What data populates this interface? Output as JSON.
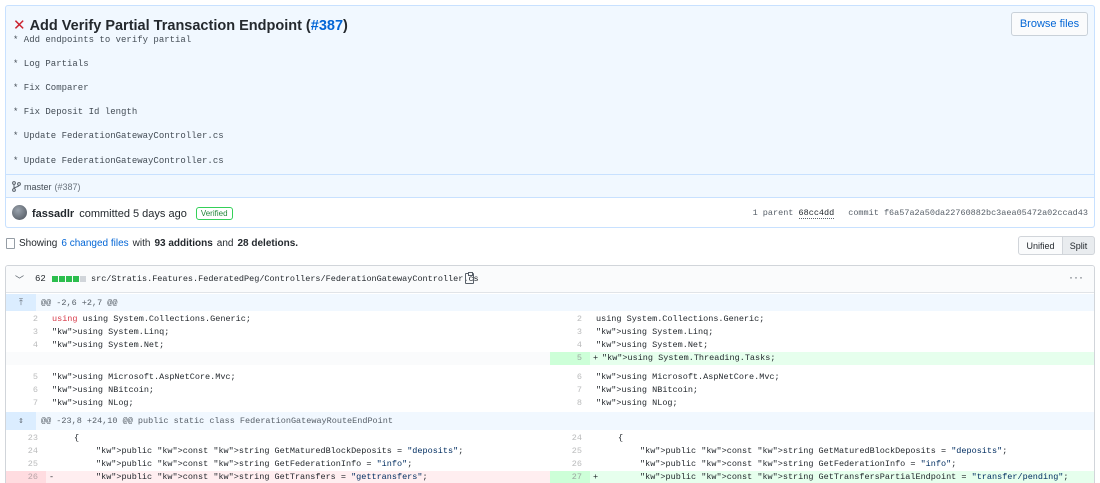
{
  "commit": {
    "status_icon": "x-icon",
    "title": "Add Verify Partial Transaction Endpoint (",
    "pr_link": "#387",
    "title_suffix": ")",
    "browse_label": "Browse files",
    "message_lines": [
      "* Add endpoints to verify partial",
      "* Log Partials",
      "* Fix Comparer",
      "* Fix Deposit Id length",
      "* Update FederationGatewayController.cs",
      "* Update FederationGatewayController.cs"
    ],
    "branch": "master",
    "branch_pr": "(#387)",
    "author": "fassadlr",
    "committed_text": "committed 5 days ago",
    "verified_label": "Verified",
    "parent_label": "1 parent",
    "parent_sha": "68cc4dd",
    "commit_label": "commit",
    "commit_sha": "f6a57a2a50da22760882bc3aea05472a02ccad43"
  },
  "summary": {
    "prefix": "Showing",
    "changed_files": "6 changed files",
    "with": "with",
    "additions": "93 additions",
    "and": "and",
    "deletions": "28 deletions."
  },
  "view_toggle": {
    "unified": "Unified",
    "split": "Split"
  },
  "file": {
    "change_count": "62",
    "path": "src/Stratis.Features.FederatedPeg/Controllers/FederationGatewayController.cs",
    "more": "···",
    "diffstat": [
      "add",
      "add",
      "add",
      "add",
      "neutral"
    ],
    "hunks": [
      {
        "header": "@@ -2,6 +2,7 @@"
      },
      {
        "header": "@@ -23,8 +24,10 @@ public static class FederationGatewayRouteEndPoint"
      }
    ],
    "lines": {
      "l1_left_num": "2",
      "l1_left": "using System.Collections.Generic;",
      "l1_right_num": "2",
      "l1_right": "using System.Collections.Generic;",
      "l2_left_num": "3",
      "l2_left": "using System.Linq;",
      "l2_right_num": "3",
      "l2_right": "using System.Linq;",
      "l3_left_num": "4",
      "l3_left": "using System.Net;",
      "l3_right_num": "4",
      "l3_right": "using System.Net;",
      "l4_right_num": "5",
      "l4_sign": "+",
      "l4_right": "using System.Threading.Tasks;",
      "l5_left_num": "5",
      "l5_left": "using Microsoft.AspNetCore.Mvc;",
      "l5_right_num": "6",
      "l5_right": "using Microsoft.AspNetCore.Mvc;",
      "l6_left_num": "6",
      "l6_left": "using NBitcoin;",
      "l6_right_num": "7",
      "l6_right": "using NBitcoin;",
      "l7_left_num": "7",
      "l7_left": "using NLog;",
      "l7_right_num": "8",
      "l7_right": "using NLog;",
      "l8_left_num": "23",
      "l8_left": "{",
      "l8_right_num": "24",
      "l8_right": "{",
      "l9_left_num": "24",
      "l9_left": "public const string GetMaturedBlockDeposits = \"deposits\";",
      "l9_right_num": "25",
      "l9_right": "public const string GetMaturedBlockDeposits = \"deposits\";",
      "l10_left_num": "25",
      "l10_left": "public const string GetFederationInfo = \"info\";",
      "l10_right_num": "26",
      "l10_right": "public const string GetFederationInfo = \"info\";",
      "l11_left_num": "26",
      "l11_left_sign": "-",
      "l11_left": "public const string GetTransfers = \"gettransfers\";",
      "l11_right_num": "27",
      "l11_right_sign": "+",
      "l11_right": "public const string GetTransfersPartialEndpoint = \"transfer/pending\";"
    }
  },
  "colors": {
    "accent": "#0366d6",
    "error": "#cb2431",
    "addition": "#e6ffed",
    "deletion": "#ffeef0",
    "hunk": "#f1f8ff"
  }
}
